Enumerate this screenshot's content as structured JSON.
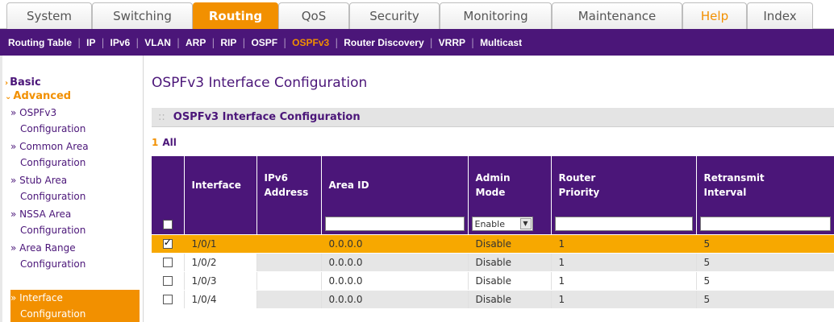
{
  "tabs": [
    {
      "label": "System"
    },
    {
      "label": "Switching"
    },
    {
      "label": "Routing"
    },
    {
      "label": "QoS"
    },
    {
      "label": "Security"
    },
    {
      "label": "Monitoring"
    },
    {
      "label": "Maintenance"
    },
    {
      "label": "Help"
    },
    {
      "label": "Index"
    }
  ],
  "subnav": [
    {
      "label": "Routing Table"
    },
    {
      "label": "IP"
    },
    {
      "label": "IPv6"
    },
    {
      "label": "VLAN"
    },
    {
      "label": "ARP"
    },
    {
      "label": "RIP"
    },
    {
      "label": "OSPF"
    },
    {
      "label": "OSPFv3"
    },
    {
      "label": "Router Discovery"
    },
    {
      "label": "VRRP"
    },
    {
      "label": "Multicast"
    }
  ],
  "sidebar": {
    "basic": "Basic",
    "advanced": "Advanced",
    "items": [
      {
        "line1": "» OSPFv3",
        "line2": "Configuration"
      },
      {
        "line1": "» Common Area",
        "line2": "Configuration"
      },
      {
        "line1": "» Stub Area",
        "line2": "Configuration"
      },
      {
        "line1": "» NSSA Area",
        "line2": "Configuration"
      },
      {
        "line1": "» Area Range",
        "line2": "Configuration"
      },
      {
        "line1": "» Interface",
        "line2": "Configuration"
      }
    ]
  },
  "page": {
    "title": "OSPFv3 Interface Configuration",
    "panel_title": "OSPFv3 Interface Configuration",
    "panel_dots": "::",
    "all_number": "1",
    "all_label": "All"
  },
  "table": {
    "headers": {
      "interface": "Interface",
      "ipv6_line1": "IPv6",
      "ipv6_line2": "Address",
      "area_id": "Area ID",
      "admin_line1": "Admin",
      "admin_line2": "Mode",
      "priority_line1": "Router",
      "priority_line2": "Priority",
      "retransmit_line1": "Retransmit",
      "retransmit_line2": "Interval"
    },
    "filter": {
      "admin_mode": "Enable"
    },
    "rows": [
      {
        "interface": "1/0/1",
        "ipv6": "",
        "area_id": "0.0.0.0",
        "admin_mode": "Disable",
        "priority": "1",
        "retransmit": "5"
      },
      {
        "interface": "1/0/2",
        "ipv6": "",
        "area_id": "0.0.0.0",
        "admin_mode": "Disable",
        "priority": "1",
        "retransmit": "5"
      },
      {
        "interface": "1/0/3",
        "ipv6": "",
        "area_id": "0.0.0.0",
        "admin_mode": "Disable",
        "priority": "1",
        "retransmit": "5"
      },
      {
        "interface": "1/0/4",
        "ipv6": "",
        "area_id": "0.0.0.0",
        "admin_mode": "Disable",
        "priority": "1",
        "retransmit": "5"
      }
    ]
  },
  "colors": {
    "brand_purple": "#4b1679",
    "accent_orange": "#f29000",
    "selected_row": "#f7a800"
  }
}
